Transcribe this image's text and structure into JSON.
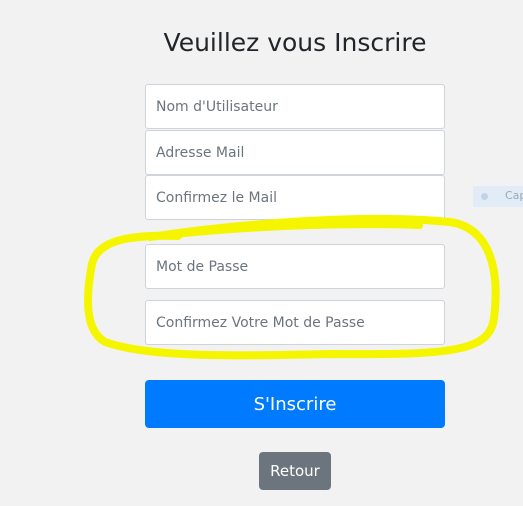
{
  "form": {
    "title": "Veuillez vous Inscrire",
    "fields": {
      "username": {
        "placeholder": "Nom d'Utilisateur",
        "value": ""
      },
      "email": {
        "placeholder": "Adresse Mail",
        "value": ""
      },
      "email_confirm": {
        "placeholder": "Confirmez le Mail",
        "value": ""
      },
      "password": {
        "placeholder": "Mot de Passe",
        "value": ""
      },
      "password_confirm": {
        "placeholder": "Confirmez Votre Mot de Passe",
        "value": ""
      }
    },
    "submit_label": "S'Inscrire",
    "back_label": "Retour"
  },
  "side_chip": {
    "label": "Cap"
  },
  "annotation": {
    "color": "#f5f500"
  },
  "colors": {
    "background": "#f2f2f2",
    "primary": "#007bff",
    "secondary": "#6c757d"
  }
}
